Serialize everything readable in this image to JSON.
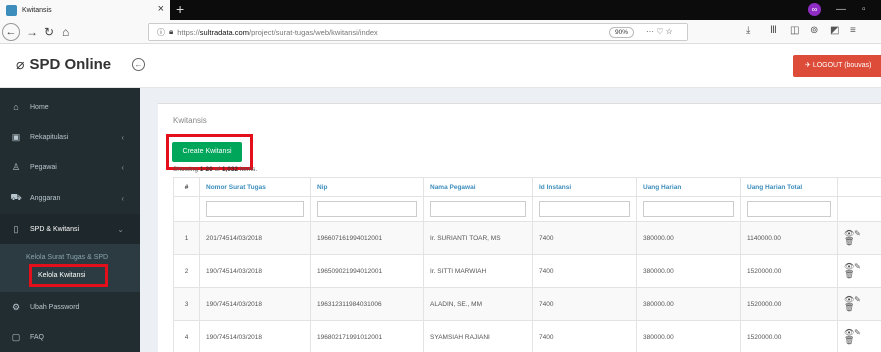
{
  "browser": {
    "tab_title": "Kwitansis",
    "url_prefix": "https://",
    "url_domain": "sultradata.com",
    "url_path": "/project/surat-tugas/web/kwitansi/index",
    "zoom": "90%"
  },
  "header": {
    "brand": "SPD Online",
    "logout_label": "LOGOUT (bouvas)"
  },
  "sidebar": {
    "items": [
      {
        "label": "Home",
        "icon": "home-icon"
      },
      {
        "label": "Rekapitulasi",
        "icon": "chart-icon"
      },
      {
        "label": "Pegawai",
        "icon": "users-icon"
      },
      {
        "label": "Anggaran",
        "icon": "cart-icon"
      },
      {
        "label": "SPD & Kwitansi",
        "icon": "file-icon"
      },
      {
        "label": "Ubah Password",
        "icon": "gear-icon"
      },
      {
        "label": "FAQ",
        "icon": "square-icon"
      }
    ],
    "subitems": [
      {
        "label": "Kelola Surat Tugas & SPD"
      },
      {
        "label": "Kelola Kwitansi"
      }
    ]
  },
  "main": {
    "title": "Kwitansis",
    "create_label": "Create Kwitansi",
    "summary_prefix": "Showing ",
    "summary_range": "1-20",
    "summary_of": " of ",
    "summary_total": "1,032",
    "summary_suffix": " items."
  },
  "table": {
    "headers": [
      "#",
      "Nomor Surat Tugas",
      "Nip",
      "Nama Pegawai",
      "Id Instansi",
      "Uang Harian",
      "Uang Harian Total"
    ],
    "rows": [
      [
        "1",
        "201/74514/03/2018",
        "196607161994012001",
        "Ir. SURIANTI TOAR, MS",
        "7400",
        "380000.00",
        "1140000.00"
      ],
      [
        "2",
        "190/74514/03/2018",
        "196509021994012001",
        "Ir. SITTI MARWIAH",
        "7400",
        "380000.00",
        "1520000.00"
      ],
      [
        "3",
        "190/74514/03/2018",
        "196312311984031006",
        "ALADIN, SE., MM",
        "7400",
        "380000.00",
        "1520000.00"
      ],
      [
        "4",
        "190/74514/03/2018",
        "196802171991012001",
        "SYAMSIAH RAJIANI",
        "7400",
        "380000.00",
        "1520000.00"
      ]
    ]
  },
  "colors": {
    "sidebar_bg": "#222d32",
    "accent_green": "#00a65a",
    "logout_red": "#dd4b39",
    "link_blue": "#3c8dbc",
    "highlight_red": "#e3101b"
  }
}
